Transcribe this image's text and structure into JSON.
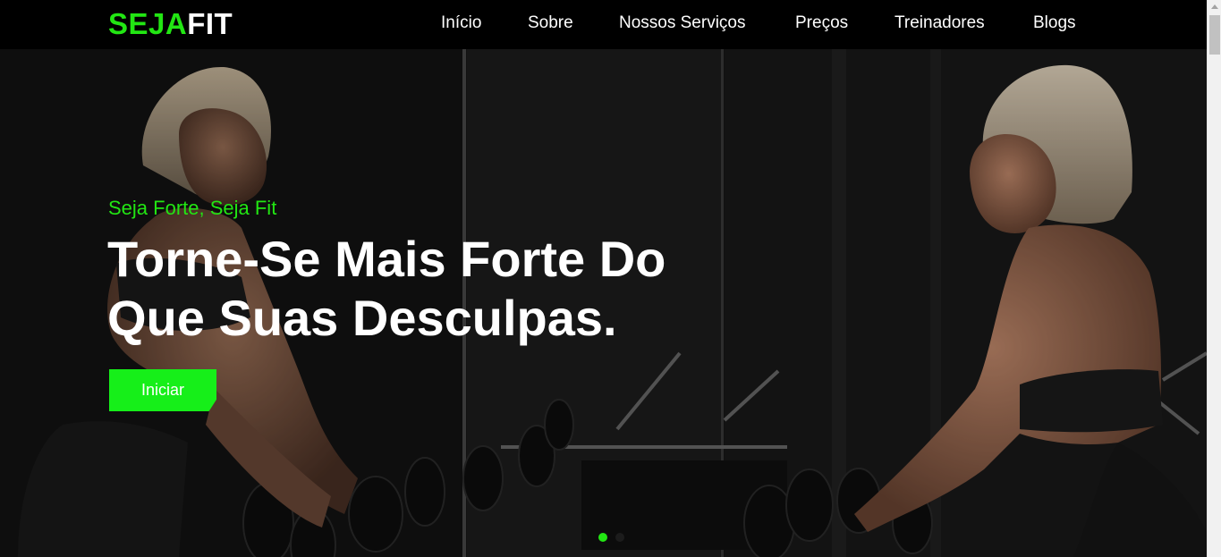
{
  "brand": {
    "part1": "SEJA",
    "part2": "FIT",
    "accent_color": "#22e613"
  },
  "nav": {
    "items": [
      {
        "label": "Início"
      },
      {
        "label": "Sobre"
      },
      {
        "label": "Nossos Serviços"
      },
      {
        "label": "Preços"
      },
      {
        "label": "Treinadores"
      },
      {
        "label": "Blogs"
      }
    ]
  },
  "hero": {
    "subtitle": "Seja Forte, Seja Fit",
    "headline_line1": "Torne-Se Mais Forte Do",
    "headline_line2": "Que Suas Desculpas.",
    "cta_label": "Iniciar",
    "cta_color": "#16ef19",
    "background_image": "woman-lifting-dumbbells-mirror-photo",
    "carousel": {
      "slides": 2,
      "active": 1
    }
  }
}
